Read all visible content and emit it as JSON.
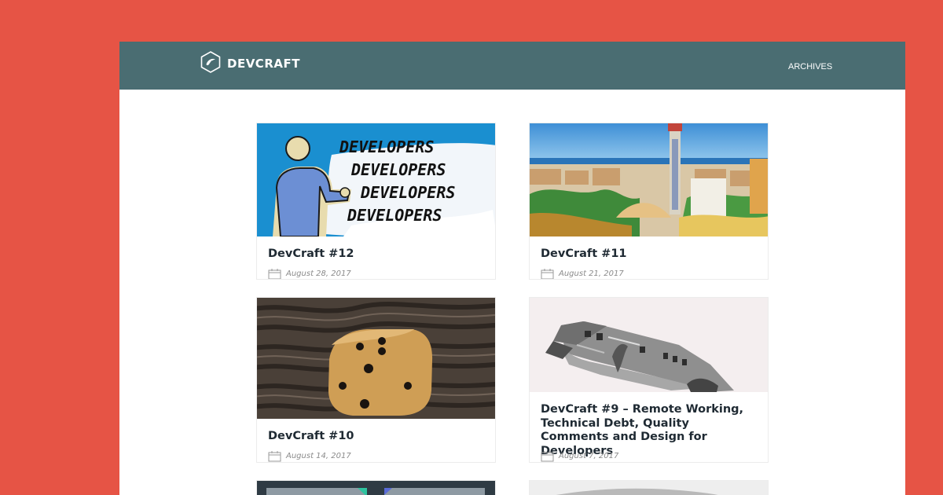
{
  "brand": {
    "name": "DEVCRAFT",
    "icon": "hexagon-logo-icon"
  },
  "nav": {
    "archives": "ARCHIVES"
  },
  "posts": [
    {
      "title": "DevCraft #12",
      "date": "August 28, 2017",
      "image": "developers-meme",
      "image_text": [
        "DEVELOPERS",
        "DEVELOPERS",
        "DEVELOPERS",
        "DEVELOPERS"
      ]
    },
    {
      "title": "DevCraft #11",
      "date": "August 21, 2017",
      "image": "city-skyline-tower"
    },
    {
      "title": "DevCraft #10",
      "date": "August 14, 2017",
      "image": "dice-closeup"
    },
    {
      "title": "DevCraft #9 – Remote Working, Technical Debt, Quality Comments and Design for Developers",
      "date": "August 7, 2017",
      "image": "crashed-plane"
    }
  ],
  "colors": {
    "background": "#e65445",
    "header": "#4a6d72",
    "card_border": "#ececec",
    "title": "#1f2a33",
    "date": "#8a8a8a"
  }
}
